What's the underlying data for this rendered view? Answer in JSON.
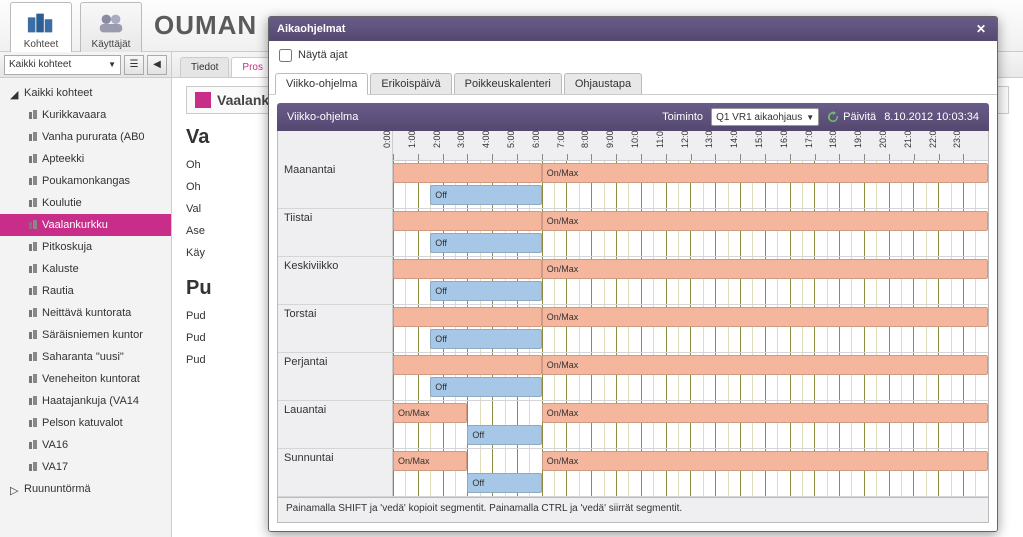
{
  "nav": {
    "kohteet": "Kohteet",
    "kayttajat": "Käyttäjät"
  },
  "brand": {
    "p1": "OUMAN",
    "p2": ""
  },
  "top_right": "",
  "left_combo": "Kaikki kohteet",
  "tree": {
    "root": "Kaikki kohteet",
    "items": [
      "Kurikkavaara",
      "Vanha pururata (AB0",
      "Apteekki",
      "Poukamonkangas",
      "Koulutie",
      "Vaalankurkku",
      "Pitkoskuja",
      "Kaluste",
      "Rautia",
      "Neittävä kuntorata",
      "Säräisniemen kuntor",
      "Saharanta \"uusi\"",
      "Veneheiton kuntorat",
      "Haatajankuja (VA14",
      "Pelson katuvalot",
      "VA16",
      "VA17"
    ],
    "footer": "Ruununtörmä",
    "selected": 5
  },
  "content_tabs": {
    "tiedot": "Tiedot",
    "pros": "Pros"
  },
  "crumb": "Vaalanku",
  "sections": {
    "s1": "Va",
    "lines1": [
      "Oh",
      "Oh",
      "Val",
      "Ase",
      "Käy"
    ],
    "s2": "Pu",
    "lines2": [
      "Pud",
      "Pud",
      "Pud"
    ]
  },
  "dialog": {
    "title": "Aikaohjelmat",
    "show_times": "Näytä ajat",
    "tabs": [
      "Viikko-ohjelma",
      "Erikoispäivä",
      "Poikkeuskalenteri",
      "Ohjaustapa"
    ],
    "active_tab": 0,
    "header": {
      "title": "Viikko-ohjelma",
      "toiminto_label": "Toiminto",
      "toiminto_value": "Q1 VR1 aikaohjaus",
      "refresh": "Päivitä",
      "timestamp": "8.10.2012 10:03:34"
    },
    "hours": [
      "0:00",
      "1:00",
      "2:00",
      "3:00",
      "4:00",
      "5:00",
      "6:00",
      "7:00",
      "8:00",
      "9:00",
      "10:00",
      "11:00",
      "12:00",
      "13:00",
      "14:00",
      "15:00",
      "16:00",
      "17:00",
      "18:00",
      "19:00",
      "20:00",
      "21:00",
      "22:00",
      "23:00"
    ],
    "labels": {
      "on": "On/Max",
      "off": "Off"
    },
    "days": [
      {
        "name": "Maanantai",
        "bars": [
          {
            "type": "on",
            "from": 0,
            "to": 6,
            "label": ""
          },
          {
            "type": "on",
            "from": 6,
            "to": 24,
            "label": "On/Max"
          },
          {
            "type": "off",
            "from": 1.5,
            "to": 6,
            "label": "Off"
          }
        ]
      },
      {
        "name": "Tiistai",
        "bars": [
          {
            "type": "on",
            "from": 0,
            "to": 6,
            "label": ""
          },
          {
            "type": "on",
            "from": 6,
            "to": 24,
            "label": "On/Max"
          },
          {
            "type": "off",
            "from": 1.5,
            "to": 6,
            "label": "Off"
          }
        ]
      },
      {
        "name": "Keskiviikko",
        "bars": [
          {
            "type": "on",
            "from": 0,
            "to": 6,
            "label": ""
          },
          {
            "type": "on",
            "from": 6,
            "to": 24,
            "label": "On/Max"
          },
          {
            "type": "off",
            "from": 1.5,
            "to": 6,
            "label": "Off"
          }
        ]
      },
      {
        "name": "Torstai",
        "bars": [
          {
            "type": "on",
            "from": 0,
            "to": 6,
            "label": ""
          },
          {
            "type": "on",
            "from": 6,
            "to": 24,
            "label": "On/Max"
          },
          {
            "type": "off",
            "from": 1.5,
            "to": 6,
            "label": "Off"
          }
        ]
      },
      {
        "name": "Perjantai",
        "bars": [
          {
            "type": "on",
            "from": 0,
            "to": 6,
            "label": ""
          },
          {
            "type": "on",
            "from": 6,
            "to": 24,
            "label": "On/Max"
          },
          {
            "type": "off",
            "from": 1.5,
            "to": 6,
            "label": "Off"
          }
        ]
      },
      {
        "name": "Lauantai",
        "bars": [
          {
            "type": "on",
            "from": 0,
            "to": 3,
            "label": "On/Max"
          },
          {
            "type": "on",
            "from": 6,
            "to": 24,
            "label": "On/Max"
          },
          {
            "type": "off",
            "from": 3,
            "to": 6,
            "label": "Off"
          }
        ]
      },
      {
        "name": "Sunnuntai",
        "bars": [
          {
            "type": "on",
            "from": 0,
            "to": 3,
            "label": "On/Max"
          },
          {
            "type": "on",
            "from": 6,
            "to": 24,
            "label": "On/Max"
          },
          {
            "type": "off",
            "from": 3,
            "to": 6,
            "label": "Off"
          }
        ]
      }
    ],
    "footer_note": "Painamalla SHIFT ja 'vedä' kopioit segmentit. Painamalla CTRL ja 'vedä' siirrät segmentit."
  }
}
